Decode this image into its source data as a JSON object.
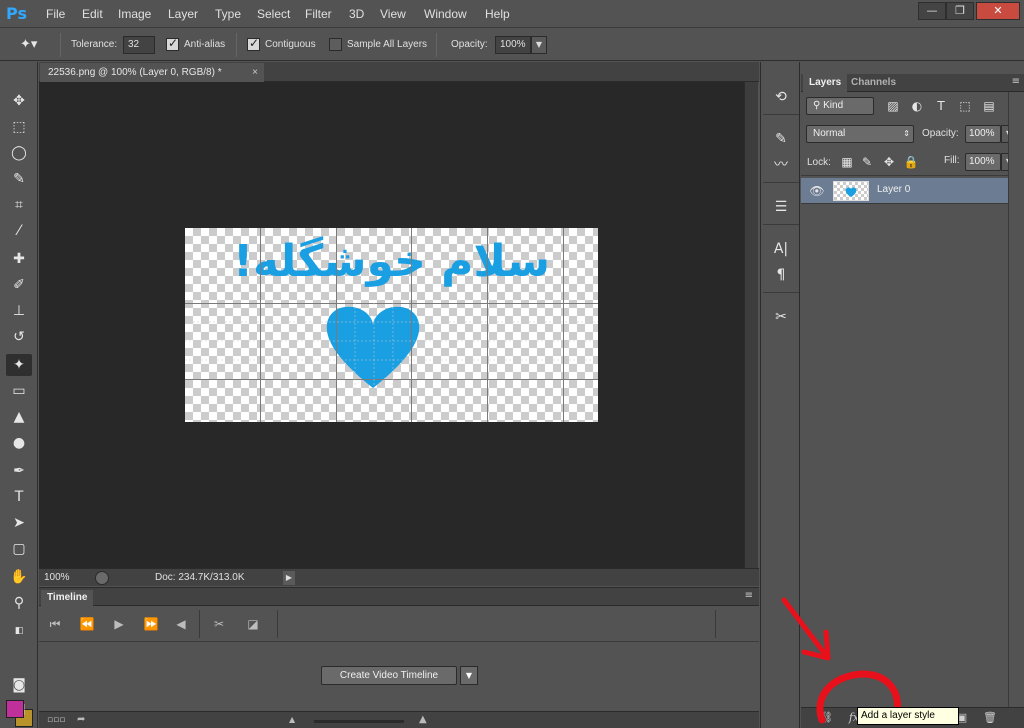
{
  "app": {
    "logo": "Ps",
    "menu": [
      "File",
      "Edit",
      "Image",
      "Layer",
      "Type",
      "Select",
      "Filter",
      "3D",
      "View",
      "Window",
      "Help"
    ],
    "window_buttons": {
      "minimize": "—",
      "restore": "❐",
      "close": "✕"
    }
  },
  "options": {
    "tolerance_label": "Tolerance:",
    "tolerance_value": "32",
    "anti_alias_label": "Anti-alias",
    "anti_alias_checked": true,
    "contiguous_label": "Contiguous",
    "contiguous_checked": true,
    "sample_all_label": "Sample All Layers",
    "sample_all_checked": false,
    "opacity_label": "Opacity:",
    "opacity_value": "100%"
  },
  "document": {
    "tab_title": "22536.png @ 100% (Layer 0, RGB/8) *",
    "close": "×",
    "image_text": "سلام خوشگله!",
    "text_color": "#1b9fe3"
  },
  "status": {
    "zoom": "100%",
    "doc_info": "Doc: 234.7K/313.0K"
  },
  "timeline": {
    "tab": "Timeline",
    "create_button": "Create Video Timeline"
  },
  "layers_panel": {
    "tabs": [
      "Layers",
      "Channels"
    ],
    "filter_kind": "Kind",
    "blend_mode": "Normal",
    "opacity_label": "Opacity:",
    "opacity_value": "100%",
    "lock_label": "Lock:",
    "fill_label": "Fill:",
    "fill_value": "100%",
    "layers": [
      {
        "name": "Layer 0",
        "visible": true,
        "selected": true
      }
    ]
  },
  "tooltip": "Add a layer style",
  "colors": {
    "foreground": "#c0309a",
    "background": "#b8932c",
    "annotation": "#e8101a"
  }
}
